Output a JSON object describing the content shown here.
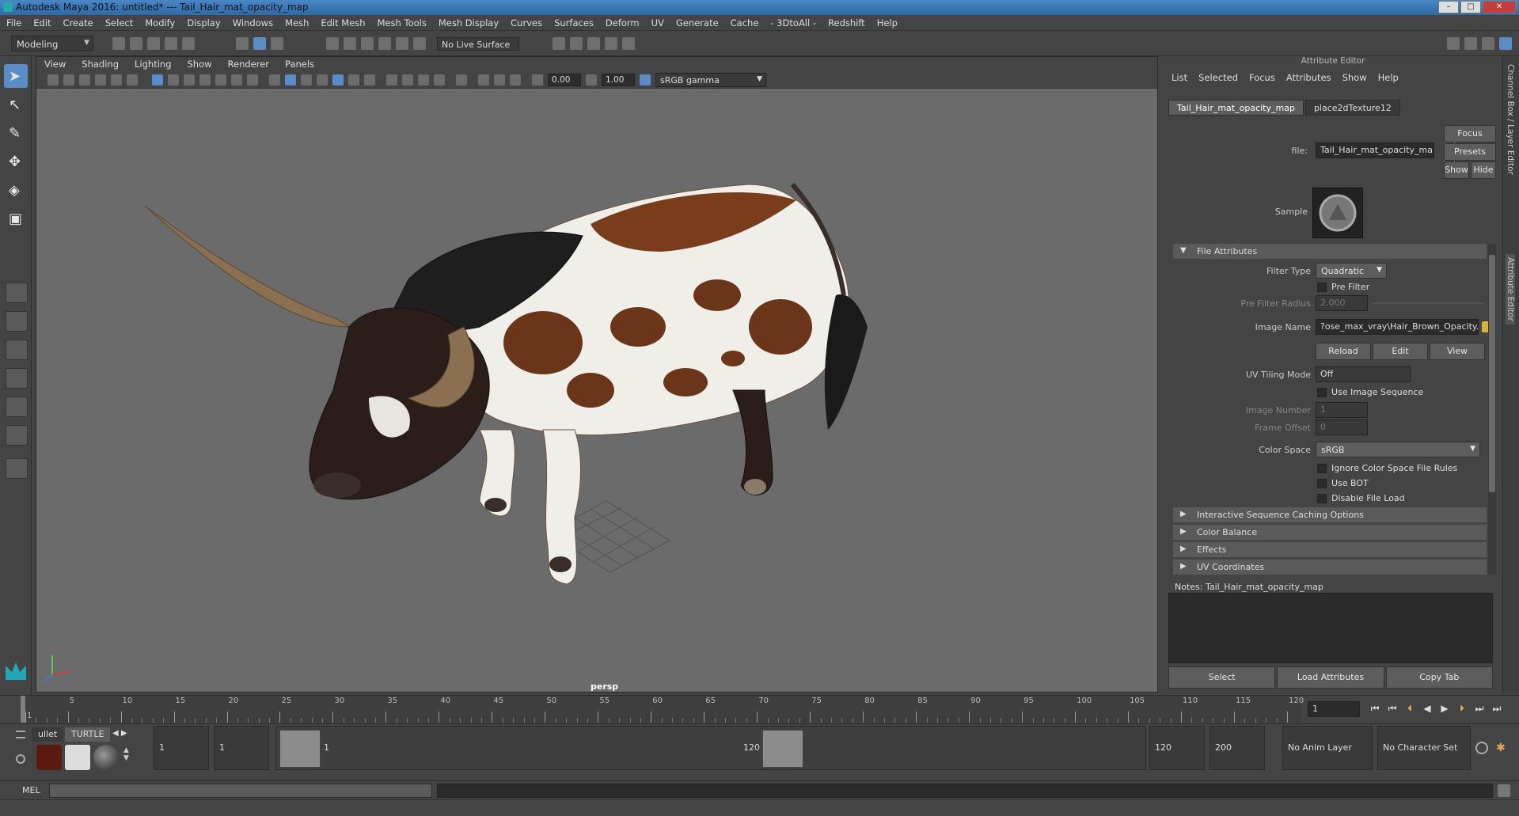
{
  "window": {
    "title": "Autodesk Maya 2016: untitled*   ---   Tail_Hair_mat_opacity_map",
    "minimize": "–",
    "maximize": "□",
    "close": "✕"
  },
  "main_menu": [
    "File",
    "Edit",
    "Create",
    "Select",
    "Modify",
    "Display",
    "Windows",
    "Mesh",
    "Edit Mesh",
    "Mesh Tools",
    "Mesh Display",
    "Curves",
    "Surfaces",
    "Deform",
    "UV",
    "Generate",
    "Cache",
    "- 3DtoAll -",
    "Redshift",
    "Help"
  ],
  "status_line": {
    "mode": "Modeling",
    "live_surface": "No Live Surface"
  },
  "viewport": {
    "menu": [
      "View",
      "Shading",
      "Lighting",
      "Show",
      "Renderer",
      "Panels"
    ],
    "exposure": "0.00",
    "gamma": "1.00",
    "color_space": "sRGB gamma",
    "camera_label": "persp"
  },
  "attribute_editor": {
    "title": "Attribute Editor",
    "menu": [
      "List",
      "Selected",
      "Focus",
      "Attributes",
      "Show",
      "Help"
    ],
    "tabs": [
      "Tail_Hair_mat_opacity_map",
      "place2dTexture12"
    ],
    "file_label": "file:",
    "file_value": "Tail_Hair_mat_opacity_map",
    "buttons_right": {
      "focus": "Focus",
      "presets": "Presets",
      "show": "Show",
      "hide": "Hide"
    },
    "sample_label": "Sample",
    "section_file": "File Attributes",
    "filter_type_label": "Filter Type",
    "filter_type": "Quadratic",
    "pre_filter": "Pre Filter",
    "pre_filter_radius_label": "Pre Filter Radius",
    "pre_filter_radius": "2.000",
    "image_name_label": "Image Name",
    "image_name": "?ose_max_vray\\Hair_Brown_Opacity.png",
    "reload": "Reload",
    "edit": "Edit",
    "view": "View",
    "uv_tiling_label": "UV Tiling Mode",
    "uv_tiling": "Off",
    "use_image_sequence": "Use Image Sequence",
    "image_number_label": "Image Number",
    "image_number": "1",
    "frame_offset_label": "Frame Offset",
    "frame_offset": "0",
    "color_space_label": "Color Space",
    "color_space": "sRGB",
    "ignore_cs_rules": "Ignore Color Space File Rules",
    "use_bot": "Use BOT",
    "disable_file_load": "Disable File Load",
    "collapsed_sections": [
      "Interactive Sequence Caching Options",
      "Color Balance",
      "Effects",
      "UV Coordinates"
    ],
    "notes_label": "Notes:  Tail_Hair_mat_opacity_map",
    "bottom_buttons": [
      "Select",
      "Load Attributes",
      "Copy Tab"
    ]
  },
  "side_tabs": [
    "Channel Box / Layer Editor",
    "Attribute Editor"
  ],
  "time_slider": {
    "ticks": [
      "1",
      "5",
      "10",
      "15",
      "20",
      "25",
      "30",
      "35",
      "40",
      "45",
      "50",
      "55",
      "60",
      "65",
      "70",
      "75",
      "80",
      "85",
      "90",
      "95",
      "100",
      "105",
      "110",
      "115",
      "120"
    ],
    "current_frame": "1"
  },
  "range_slider": {
    "shelf_tabs": [
      "ullet",
      "TURTLE"
    ],
    "start_time": "1",
    "playback_start": "1",
    "range_start": "1",
    "range_end": "120",
    "playback_end": "120",
    "end_time": "200",
    "anim_layer": "No Anim Layer",
    "character_set": "No Character Set"
  },
  "command_line": {
    "label": "MEL"
  },
  "colors": {
    "accent": "#5a8dc8",
    "viewport_bg": "#6b6b6b",
    "panel_bg": "#444444"
  }
}
